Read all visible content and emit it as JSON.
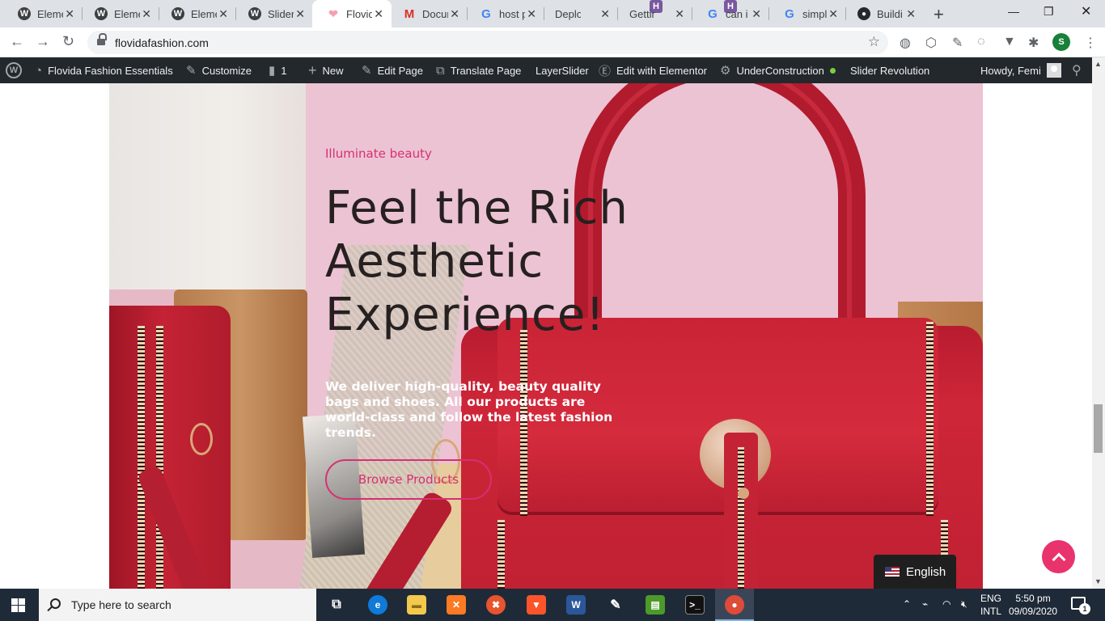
{
  "browser": {
    "tabs": [
      {
        "title": "Eleme",
        "icon": "wordpress-icon",
        "active": false
      },
      {
        "title": "Eleme",
        "icon": "wordpress-icon",
        "active": false
      },
      {
        "title": "Eleme",
        "icon": "wordpress-icon",
        "active": false
      },
      {
        "title": "Slider",
        "icon": "wordpress-icon",
        "active": false
      },
      {
        "title": "Flovid",
        "icon": "flovida-favicon",
        "active": true
      },
      {
        "title": "Docur",
        "icon": "gmail-icon",
        "active": false
      },
      {
        "title": "host p",
        "icon": "google-icon",
        "active": false
      },
      {
        "title": "Deplo",
        "icon": "heroku-icon",
        "active": false
      },
      {
        "title": "Gettin",
        "icon": "heroku-icon",
        "active": false
      },
      {
        "title": "can i l",
        "icon": "google-icon",
        "active": false
      },
      {
        "title": "simpl",
        "icon": "google-icon",
        "active": false
      },
      {
        "title": "Buildi",
        "icon": "github-icon",
        "active": false
      }
    ],
    "url": "flovidafashion.com",
    "profile_initial": "S"
  },
  "adminbar": {
    "site_name": "Flovida Fashion Essentials",
    "customize": "Customize",
    "comments_count": "1",
    "new": "New",
    "edit_page": "Edit Page",
    "translate_page": "Translate Page",
    "layerslider": "LayerSlider",
    "edit_elementor": "Edit with Elementor",
    "under_construction": "UnderConstruction",
    "slider_revolution": "Slider Revolution",
    "howdy": "Howdy, Femi"
  },
  "hero": {
    "subtitle": "Illuminate beauty",
    "headline_1": "Feel the Rich",
    "headline_2": "Aesthetic",
    "headline_3": "Experience!",
    "description": "We deliver high-quality, beauty quality bags and shoes. All our products are world-class and follow the latest fashion trends.",
    "button": "Browse Products"
  },
  "language_switcher": "English",
  "taskbar": {
    "search_placeholder": "Type here to search",
    "lang_1": "ENG",
    "lang_2": "INTL",
    "time": "5:50 pm",
    "date": "09/09/2020",
    "notifications": "1"
  },
  "colors": {
    "accent_pink": "#d63072",
    "admin_bar": "#23282d",
    "hero_bg": "#ecc3d3",
    "bag_red": "#c42335"
  }
}
